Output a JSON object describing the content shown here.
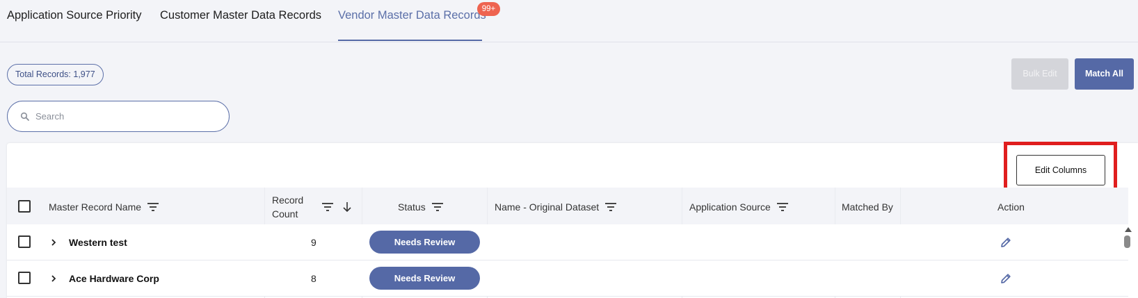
{
  "tabs": [
    {
      "label": "Application Source Priority"
    },
    {
      "label": "Customer Master Data Records"
    },
    {
      "label": "Vendor Master Data Records",
      "badge": "99+",
      "active": true
    }
  ],
  "toolbar": {
    "total_records": "Total Records: 1,977",
    "bulk_edit_label": "Bulk Edit",
    "match_all_label": "Match All",
    "edit_columns_label": "Edit Columns"
  },
  "search": {
    "placeholder": "Search",
    "value": ""
  },
  "table": {
    "columns": [
      {
        "label": "Master Record Name"
      },
      {
        "label": "Record",
        "label2": "Count"
      },
      {
        "label": "Status"
      },
      {
        "label": "Name - Original Dataset"
      },
      {
        "label": "Application Source"
      },
      {
        "label": "Matched By"
      },
      {
        "label": "Action"
      }
    ],
    "rows": [
      {
        "name": "Western test",
        "count": "9",
        "status": "Needs Review"
      },
      {
        "name": "Ace Hardware Corp",
        "count": "8",
        "status": "Needs Review"
      }
    ]
  },
  "colors": {
    "accent": "#5569a6",
    "badge": "#ee6350",
    "highlight": "#e01e1e"
  },
  "icons": [
    "search-icon",
    "filter-icon",
    "sort-down-icon",
    "chevron-right-icon",
    "pencil-icon"
  ]
}
